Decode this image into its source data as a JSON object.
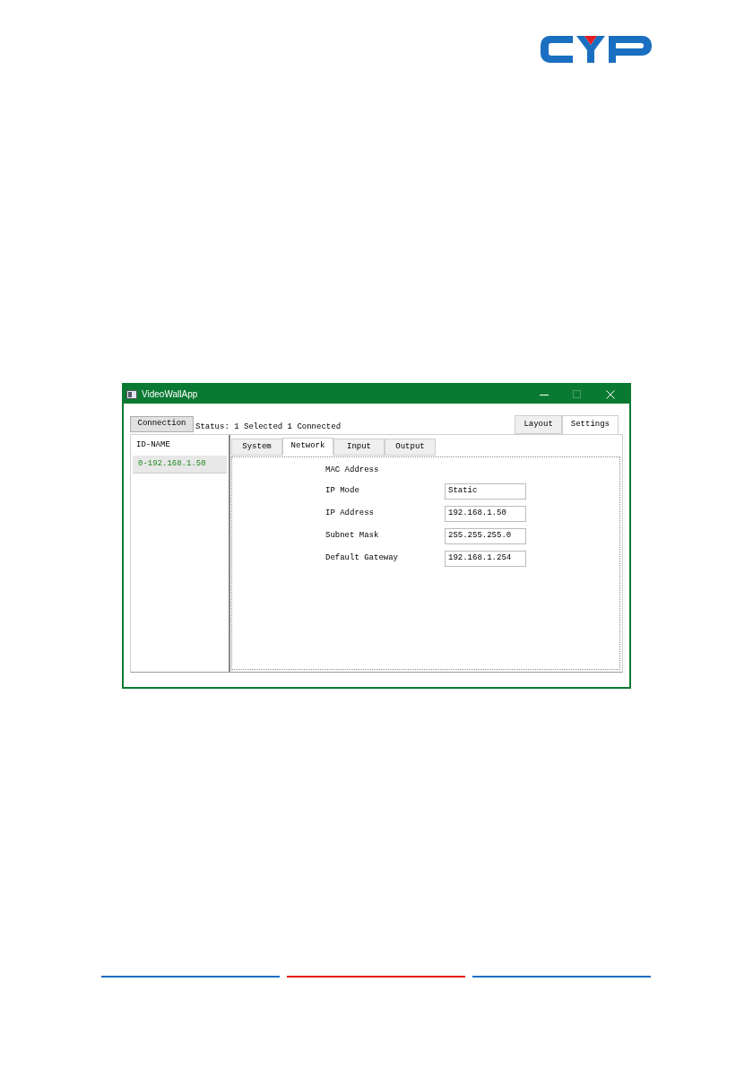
{
  "window": {
    "title": "VideoWallApp"
  },
  "toolbar": {
    "connection_button": "Connection",
    "status": "Status: 1 Selected 1 Connected"
  },
  "view_tabs": [
    {
      "label": "Layout",
      "selected": false
    },
    {
      "label": "Settings",
      "selected": true
    }
  ],
  "device_list": {
    "header": "ID-NAME",
    "items": [
      {
        "label": "0-192.168.1.50",
        "selected": true
      }
    ]
  },
  "settings_tabs": [
    {
      "label": "System",
      "selected": false
    },
    {
      "label": "Network",
      "selected": true
    },
    {
      "label": "Input",
      "selected": false
    },
    {
      "label": "Output",
      "selected": false
    }
  ],
  "network_fields": [
    {
      "kind": "label",
      "label": "MAC Address"
    },
    {
      "kind": "field",
      "label": "IP Mode",
      "value": "Static"
    },
    {
      "kind": "field",
      "label": "IP Address",
      "value": "192.168.1.50"
    },
    {
      "kind": "field",
      "label": "Subnet Mask",
      "value": "255.255.255.0"
    },
    {
      "kind": "field",
      "label": "Default Gateway",
      "value": "192.168.1.254"
    }
  ]
}
